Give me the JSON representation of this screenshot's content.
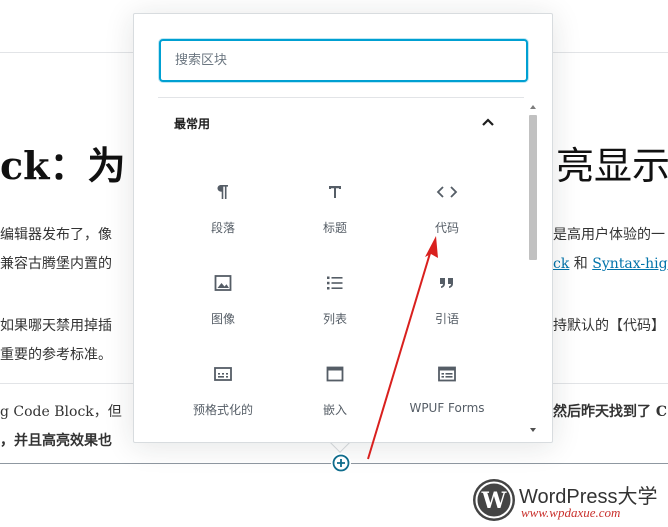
{
  "background": {
    "heading_left": "ck：为",
    "heading_right": "亮显示",
    "para1_line1_left": "编辑器发布了，像",
    "para1_line1_right": "是高用户体验的一",
    "para1_line2_left": "兼容古腾堡内置的",
    "para1_link1": "ck",
    "para1_and": " 和 ",
    "para1_link2": "Syntax-hig",
    "para2_line1_left": "如果哪天禁用掉插",
    "para2_line1_right": "持默认的【代码】",
    "para2_line2_left": "重要的参考标准。",
    "para3_line1_left": "g Code Block，但",
    "para3_line1_right": "然后昨天找到了 C",
    "para3_line2_left": "，并且高亮效果也"
  },
  "inserter": {
    "search_placeholder": "搜索区块",
    "section_title": "最常用",
    "blocks": [
      {
        "label": "段落",
        "icon": "paragraph-icon"
      },
      {
        "label": "标题",
        "icon": "heading-icon"
      },
      {
        "label": "代码",
        "icon": "code-icon"
      },
      {
        "label": "图像",
        "icon": "image-icon"
      },
      {
        "label": "列表",
        "icon": "list-icon"
      },
      {
        "label": "引语",
        "icon": "quote-icon"
      },
      {
        "label": "预格式化的",
        "icon": "preformatted-icon"
      },
      {
        "label": "嵌入",
        "icon": "embed-icon"
      },
      {
        "label": "WPUF Forms",
        "icon": "forms-icon"
      }
    ]
  },
  "watermark": {
    "brand": "WordPress大学",
    "url": "www.wpdaxue.com"
  },
  "colors": {
    "accent": "#00a0d2",
    "annotation_arrow": "#d9201e",
    "icon": "#555d66",
    "link": "#0073aa"
  }
}
